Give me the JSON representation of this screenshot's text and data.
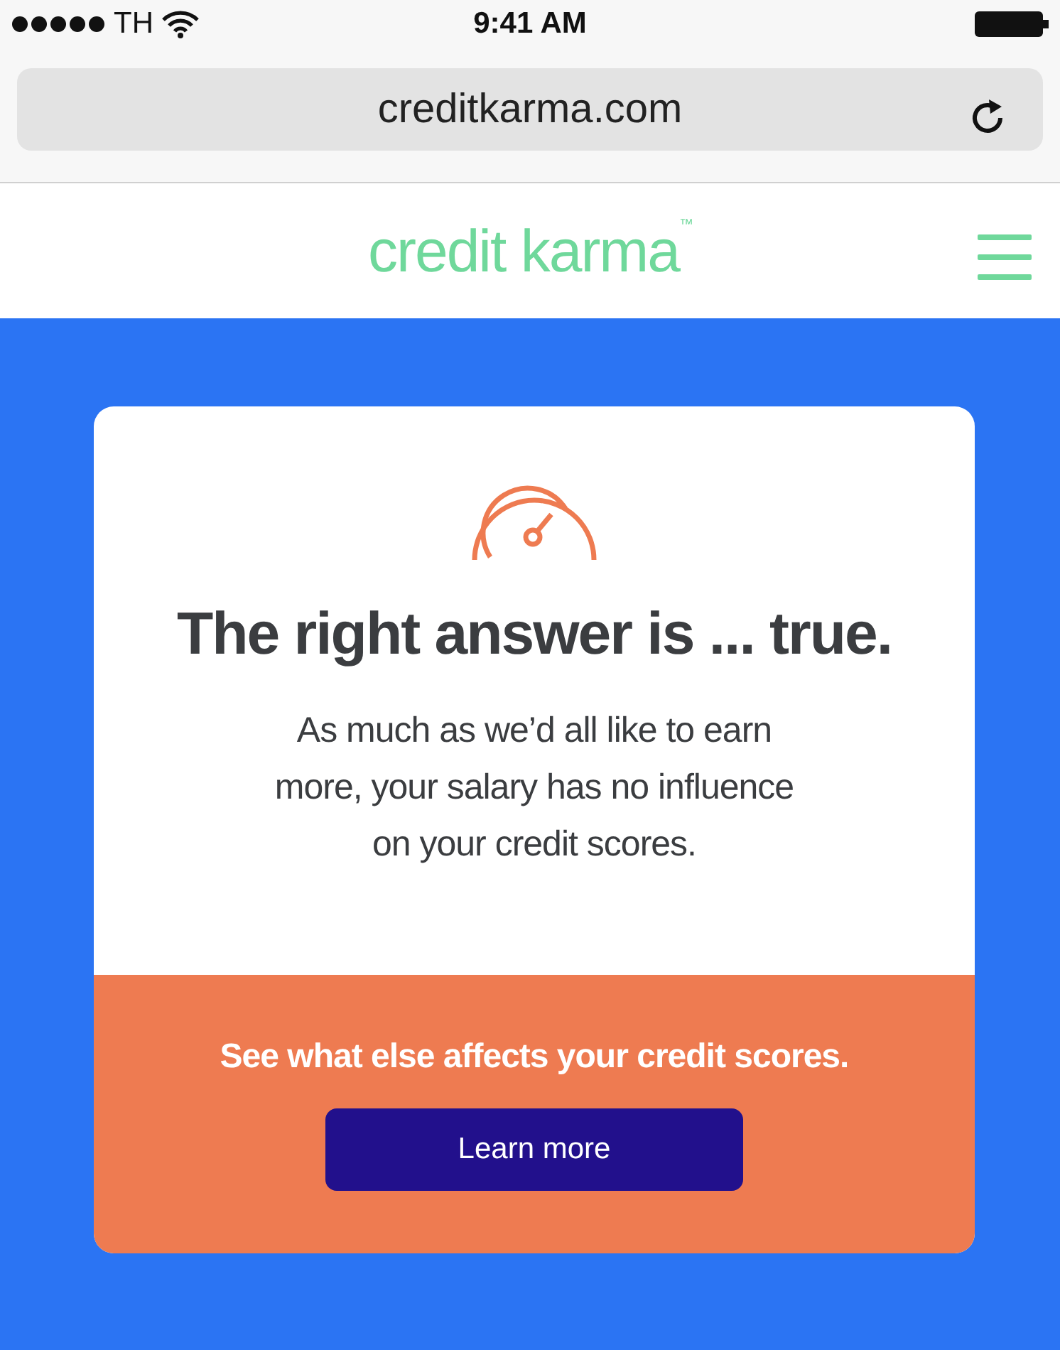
{
  "status_bar": {
    "carrier": "TH",
    "time": "9:41 AM"
  },
  "browser": {
    "url": "creditkarma.com"
  },
  "header": {
    "logo": "credit karma",
    "logo_mark": "™"
  },
  "card": {
    "heading": "The right answer is ... true.",
    "body": "As much as we’d all like to earn more, your salary has no influence on your credit scores.",
    "cta_text": "See what else affects your credit scores.",
    "button": "Learn more"
  }
}
